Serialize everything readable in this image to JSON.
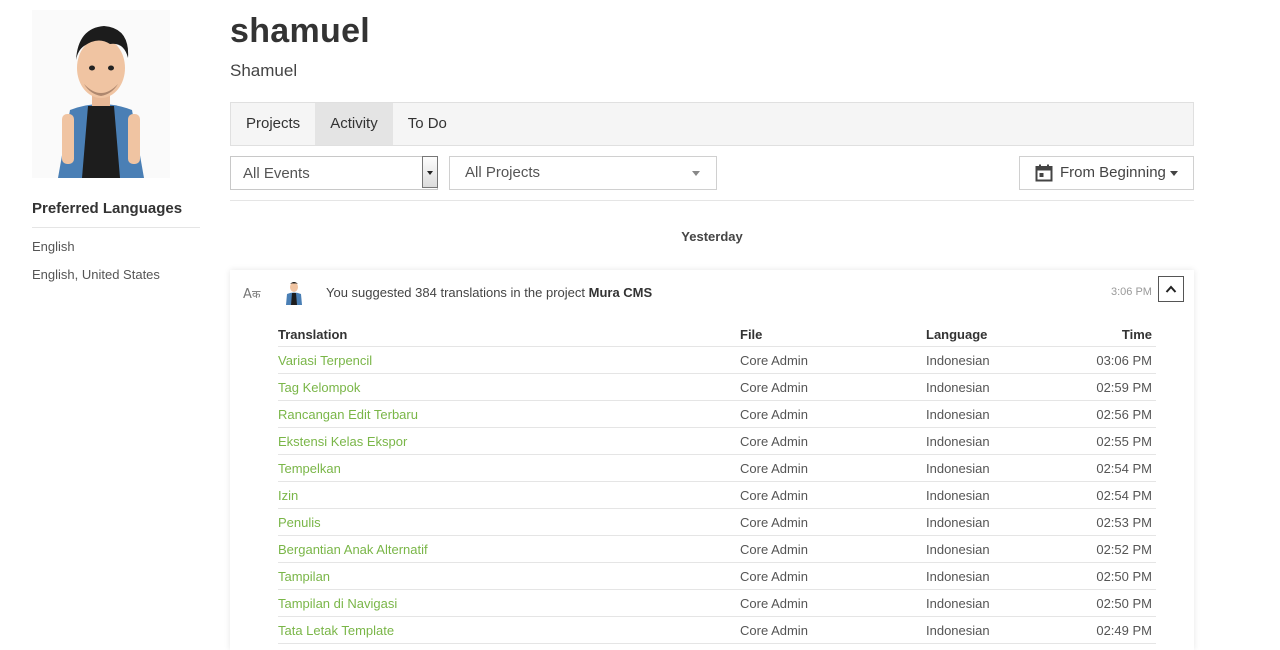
{
  "profile": {
    "username": "shamuel",
    "display_name": "Shamuel",
    "preferred_languages_title": "Preferred Languages",
    "languages": [
      "English",
      "English, United States"
    ]
  },
  "tabs": [
    {
      "label": "Projects",
      "active": false
    },
    {
      "label": "Activity",
      "active": true
    },
    {
      "label": "To Do",
      "active": false
    }
  ],
  "filters": {
    "events": "All Events",
    "projects": "All Projects",
    "date_range": "From Beginning"
  },
  "day_label": "Yesterday",
  "activity": {
    "summary_prefix": "You suggested 384 translations in the project",
    "project": "Mura CMS",
    "time": "3:06 PM",
    "columns": [
      "Translation",
      "File",
      "Language",
      "Time"
    ],
    "rows": [
      {
        "translation": "Variasi Terpencil",
        "file": "Core Admin",
        "language": "Indonesian",
        "time": "03:06 PM"
      },
      {
        "translation": "Tag Kelompok",
        "file": "Core Admin",
        "language": "Indonesian",
        "time": "02:59 PM"
      },
      {
        "translation": "Rancangan Edit Terbaru",
        "file": "Core Admin",
        "language": "Indonesian",
        "time": "02:56 PM"
      },
      {
        "translation": "Ekstensi Kelas Ekspor",
        "file": "Core Admin",
        "language": "Indonesian",
        "time": "02:55 PM"
      },
      {
        "translation": "Tempelkan",
        "file": "Core Admin",
        "language": "Indonesian",
        "time": "02:54 PM"
      },
      {
        "translation": "Izin",
        "file": "Core Admin",
        "language": "Indonesian",
        "time": "02:54 PM"
      },
      {
        "translation": "Penulis",
        "file": "Core Admin",
        "language": "Indonesian",
        "time": "02:53 PM"
      },
      {
        "translation": "Bergantian Anak Alternatif",
        "file": "Core Admin",
        "language": "Indonesian",
        "time": "02:52 PM"
      },
      {
        "translation": "Tampilan",
        "file": "Core Admin",
        "language": "Indonesian",
        "time": "02:50 PM"
      },
      {
        "translation": "Tampilan di Navigasi",
        "file": "Core Admin",
        "language": "Indonesian",
        "time": "02:50 PM"
      },
      {
        "translation": "Tata Letak Template",
        "file": "Core Admin",
        "language": "Indonesian",
        "time": "02:49 PM"
      }
    ]
  },
  "colors": {
    "translation_link": "#7ab648",
    "active_tab_bg": "#e4e4e4"
  },
  "icons": [
    "translate-icon",
    "calendar-icon",
    "chevron-up-icon",
    "caret-down-icon"
  ]
}
